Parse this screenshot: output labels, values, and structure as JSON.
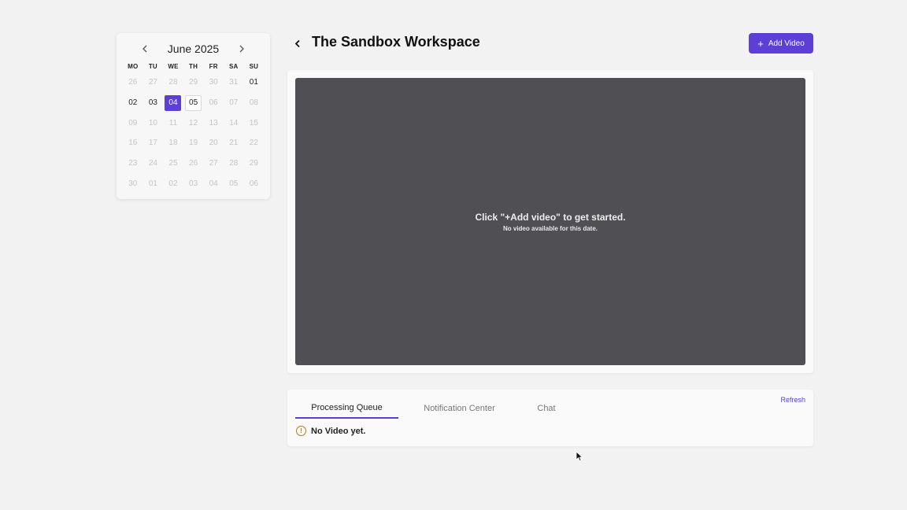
{
  "calendar": {
    "month_label": "June 2025",
    "weekdays": [
      "MO",
      "TU",
      "WE",
      "TH",
      "FR",
      "SA",
      "SU"
    ],
    "days": [
      {
        "label": "26",
        "state": "muted"
      },
      {
        "label": "27",
        "state": "muted"
      },
      {
        "label": "28",
        "state": "muted"
      },
      {
        "label": "29",
        "state": "muted"
      },
      {
        "label": "30",
        "state": "muted"
      },
      {
        "label": "31",
        "state": "muted"
      },
      {
        "label": "01",
        "state": "active"
      },
      {
        "label": "02",
        "state": "active"
      },
      {
        "label": "03",
        "state": "active"
      },
      {
        "label": "04",
        "state": "selected"
      },
      {
        "label": "05",
        "state": "today"
      },
      {
        "label": "06",
        "state": "muted"
      },
      {
        "label": "07",
        "state": "muted"
      },
      {
        "label": "08",
        "state": "muted"
      },
      {
        "label": "09",
        "state": "muted"
      },
      {
        "label": "10",
        "state": "muted"
      },
      {
        "label": "11",
        "state": "muted"
      },
      {
        "label": "12",
        "state": "muted"
      },
      {
        "label": "13",
        "state": "muted"
      },
      {
        "label": "14",
        "state": "muted"
      },
      {
        "label": "15",
        "state": "muted"
      },
      {
        "label": "16",
        "state": "muted"
      },
      {
        "label": "17",
        "state": "muted"
      },
      {
        "label": "18",
        "state": "muted"
      },
      {
        "label": "19",
        "state": "muted"
      },
      {
        "label": "20",
        "state": "muted"
      },
      {
        "label": "21",
        "state": "muted"
      },
      {
        "label": "22",
        "state": "muted"
      },
      {
        "label": "23",
        "state": "muted"
      },
      {
        "label": "24",
        "state": "muted"
      },
      {
        "label": "25",
        "state": "muted"
      },
      {
        "label": "26",
        "state": "muted"
      },
      {
        "label": "27",
        "state": "muted"
      },
      {
        "label": "28",
        "state": "muted"
      },
      {
        "label": "29",
        "state": "muted"
      },
      {
        "label": "30",
        "state": "muted"
      },
      {
        "label": "01",
        "state": "muted"
      },
      {
        "label": "02",
        "state": "muted"
      },
      {
        "label": "03",
        "state": "muted"
      },
      {
        "label": "04",
        "state": "muted"
      },
      {
        "label": "05",
        "state": "muted"
      },
      {
        "label": "06",
        "state": "muted"
      }
    ],
    "prev_icon": "chevron-left-icon",
    "next_icon": "chevron-right-icon"
  },
  "header": {
    "title": "The Sandbox Workspace",
    "back_icon": "chevron-left-icon",
    "add_video_label": "Add Video",
    "add_video_icon": "plus-icon"
  },
  "video": {
    "main_text": "Click \"+Add video\" to get started.",
    "sub_text": "No video available for this date."
  },
  "queue": {
    "tabs": [
      {
        "label": "Processing Queue",
        "active": true
      },
      {
        "label": "Notification Center",
        "active": false
      },
      {
        "label": "Chat",
        "active": false
      }
    ],
    "refresh_label": "Refresh",
    "empty_text": "No Video yet.",
    "empty_icon": "warning-circle-icon"
  },
  "colors": {
    "accent": "#5b3fd6",
    "video_bg": "#504f54",
    "warning": "#b77b19",
    "page_bg": "#f2f2f2"
  }
}
